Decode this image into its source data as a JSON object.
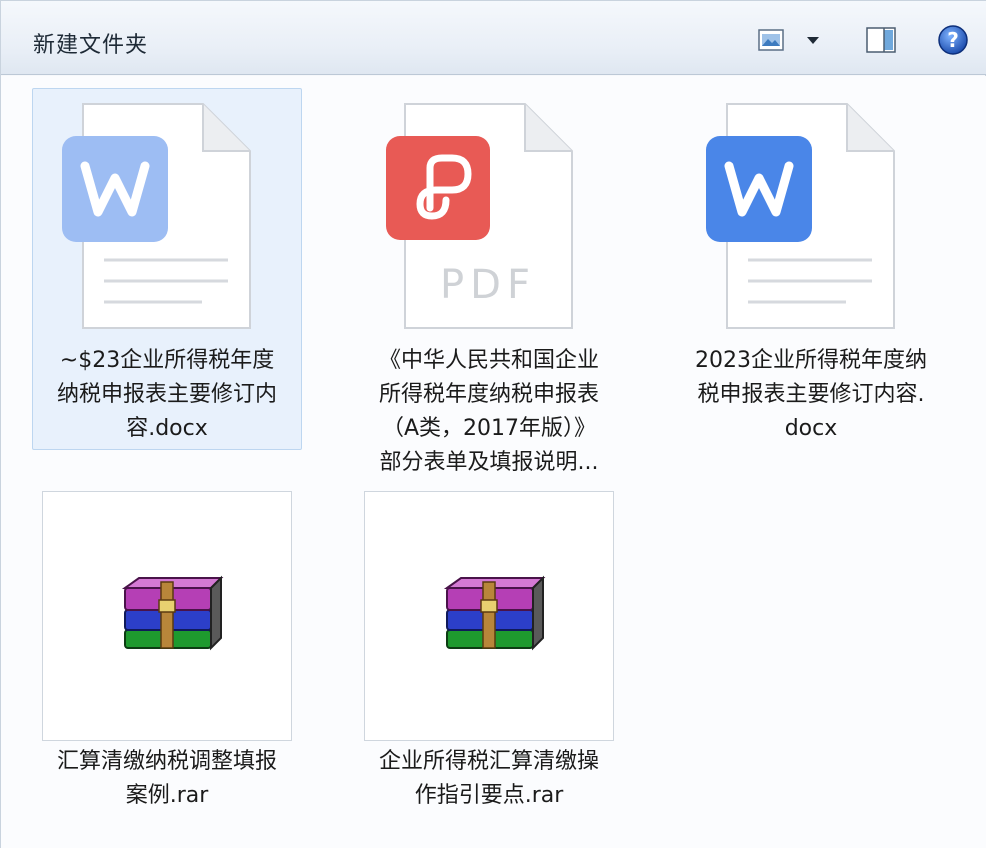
{
  "window": {
    "title": "新建文件夹"
  },
  "toolbar": {
    "view_icon": "views-icon",
    "dropdown_icon": "chevron-down-icon",
    "pane_icon": "preview-pane-icon",
    "help_icon": "help-icon"
  },
  "files": [
    {
      "type": "docx",
      "icon": "wps-writer-icon",
      "selected": true,
      "name_lines": [
        "~$23企业所得税年度",
        "纳税申报表主要修订内",
        "容.docx"
      ]
    },
    {
      "type": "pdf",
      "icon": "pdf-icon",
      "badge": "PDF",
      "selected": false,
      "name_lines": [
        "《中华人民共和国企业",
        "所得税年度纳税申报表",
        "（A类，2017年版）》",
        "部分表单及填报说明..."
      ]
    },
    {
      "type": "docx",
      "icon": "wps-writer-icon",
      "selected": false,
      "name_lines": [
        "2023企业所得税年度纳",
        "税申报表主要修订内容.",
        "docx"
      ]
    },
    {
      "type": "rar",
      "icon": "winrar-archive-icon",
      "selected": false,
      "name_lines": [
        "汇算清缴纳税调整填报",
        "案例.rar"
      ]
    },
    {
      "type": "rar",
      "icon": "winrar-archive-icon",
      "selected": false,
      "name_lines": [
        "企业所得税汇算清缴操",
        "作指引要点.rar"
      ]
    }
  ],
  "colors": {
    "selection_bg": "#e8f1fc",
    "selection_border": "#bdd6f0",
    "wps_blue": "#4a86e8",
    "wps_blue_faded": "#9dbdf3",
    "pdf_red": "#e85a55"
  }
}
